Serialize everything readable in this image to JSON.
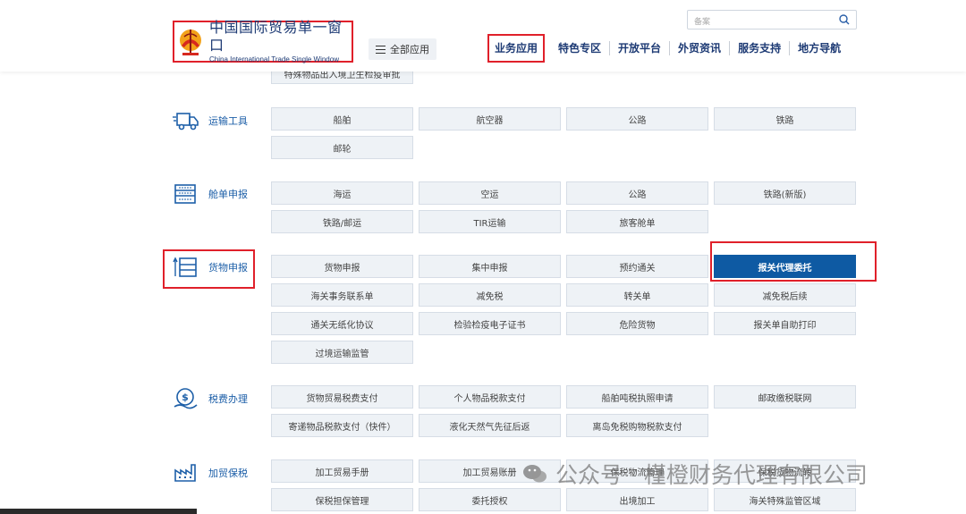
{
  "header": {
    "logo_cn": "中国国际贸易单一窗口",
    "logo_en": "China International Trade Single Window",
    "all_apps_label": "全部应用",
    "search_placeholder": "备案",
    "nav": [
      "业务应用",
      "特色专区",
      "开放平台",
      "外贸资讯",
      "服务支持",
      "地方导航"
    ]
  },
  "partial_top_tile": "特殊物品出入境卫生检疫审批",
  "sections": [
    {
      "label": "运输工具",
      "icon": "truck-icon",
      "tiles": [
        "船舶",
        "航空器",
        "公路",
        "铁路",
        "邮轮"
      ]
    },
    {
      "label": "舱单申报",
      "icon": "manifest-icon",
      "tiles": [
        "海运",
        "空运",
        "公路",
        "铁路(新版)",
        "铁路/邮运",
        "TIR运输",
        "旅客舱单"
      ]
    },
    {
      "label": "货物申报",
      "icon": "cargo-declare-icon",
      "tiles": [
        "货物申报",
        "集中申报",
        "预约通关",
        "报关代理委托",
        "海关事务联系单",
        "减免税",
        "转关单",
        "减免税后续",
        "通关无纸化协议",
        "检验检疫电子证书",
        "危险货物",
        "报关单自助打印",
        "过境运输监管"
      ]
    },
    {
      "label": "税费办理",
      "icon": "tax-payment-icon",
      "tiles": [
        "货物贸易税费支付",
        "个人物品税款支付",
        "船舶吨税执照申请",
        "邮政缴税联网",
        "寄递物品税款支付（快件）",
        "液化天然气先征后返",
        "离岛免税购物税款支付"
      ]
    },
    {
      "label": "加贸保税",
      "icon": "factory-icon",
      "tiles": [
        "加工贸易手册",
        "加工贸易账册",
        "保税物流管理",
        "保税货物流转",
        "保税担保管理",
        "委托授权",
        "出境加工",
        "海关特殊监管区域"
      ]
    }
  ],
  "selected_tile": "报关代理委托",
  "watermark": "公众号 · 槿橙财务代理有限公司",
  "colors": {
    "brand": "#1d3a74",
    "link": "#1d5fa8",
    "selected": "#0e5aa3",
    "highlight": "#e0202a",
    "tile_bg": "#eef2f6"
  }
}
